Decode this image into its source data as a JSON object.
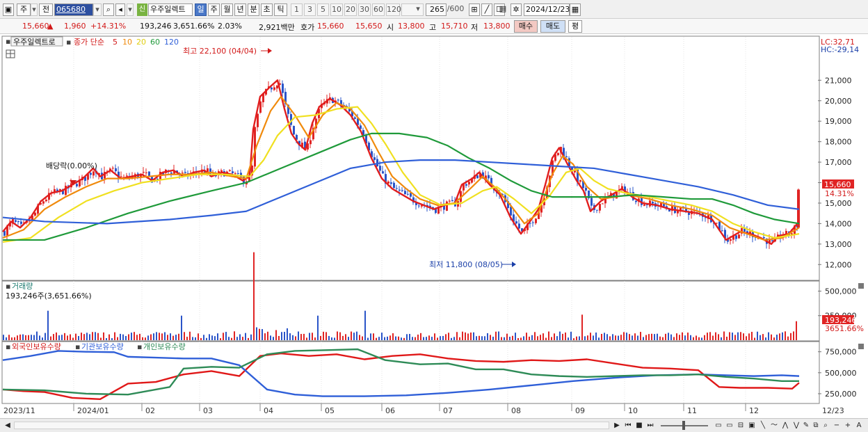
{
  "toolbar": {
    "market": "주",
    "prev": "전",
    "code": "065680",
    "name": "우주일렉트",
    "sin_badge": "신",
    "periods": [
      "일",
      "주",
      "월",
      "년",
      "분",
      "초",
      "틱"
    ],
    "ticks": [
      "1",
      "3",
      "5",
      "10",
      "20",
      "30",
      "60",
      "120"
    ],
    "count": "265",
    "count_total": "/600",
    "date": "2024/12/23"
  },
  "quote": {
    "price": "15,660",
    "change": "1,960",
    "change_pct": "+14.31%",
    "volume": "193,246",
    "volume_ratio": "3,651.66%",
    "turnover_pct": "2.03%",
    "amount": "2,921백만",
    "hoga_label": "호가",
    "ask": "15,660",
    "bid": "15,650",
    "open_label": "시",
    "open": "13,800",
    "high_label": "고",
    "high": "15,710",
    "low_label": "저",
    "low": "13,800",
    "buy": "매수",
    "sell": "매도",
    "eval": "평"
  },
  "price_panel": {
    "name": "우주일렉트로",
    "ma_title": "종가 단순",
    "ma_periods": [
      {
        "label": "5",
        "color": "#e11d1d"
      },
      {
        "label": "10",
        "color": "#f08a0c"
      },
      {
        "label": "20",
        "color": "#f0e020"
      },
      {
        "label": "60",
        "color": "#1f9a3a"
      },
      {
        "label": "120",
        "color": "#2f5fd8"
      }
    ],
    "lc": "LC:32,71",
    "hc": "HC:-29,14",
    "y_ticks": [
      "21,000",
      "20,000",
      "19,000",
      "18,000",
      "17,000",
      "16,000",
      "15,000",
      "14,000",
      "13,000",
      "12,000"
    ],
    "last_price_tag": "15,660",
    "last_pct_tag": "14.31%",
    "high_note": "최고 22,100 (04/04)",
    "low_note": "최저 11,800 (08/05)",
    "dividend_note": "배당락(0.00%)"
  },
  "volume_panel": {
    "title": "거래량",
    "value": "193,246주(3,651.66%)",
    "y_ticks": [
      "500,000",
      "250,000"
    ],
    "last_tag": "193,246",
    "pct_tag": "3651.66%"
  },
  "holdings_panel": {
    "series": [
      {
        "label": "외국인보유수량",
        "color": "#e01818"
      },
      {
        "label": "기관보유수량",
        "color": "#2f5fd8"
      },
      {
        "label": "개인보유수량",
        "color": "#2e8b57"
      }
    ],
    "y_ticks": [
      "750,000",
      "500,000",
      "250,000"
    ]
  },
  "x_axis": {
    "labels": [
      "2023/11",
      "2024/01",
      "02",
      "03",
      "04",
      "05",
      "06",
      "07",
      "08",
      "09",
      "10",
      "11",
      "12",
      "12/23"
    ]
  },
  "chart_data": {
    "type": "line",
    "title": "",
    "price_ylim": [
      11500,
      22200
    ],
    "volume_ylim": [
      0,
      560000
    ],
    "holdings_ylim": [
      150000,
      830000
    ],
    "ma": {
      "ma5": [
        [
          0,
          13600
        ],
        [
          12,
          14100
        ],
        [
          25,
          13800
        ],
        [
          40,
          14300
        ],
        [
          55,
          15100
        ],
        [
          70,
          15500
        ],
        [
          85,
          15600
        ],
        [
          100,
          15900
        ],
        [
          115,
          16200
        ],
        [
          130,
          16700
        ],
        [
          140,
          16300
        ],
        [
          155,
          16600
        ],
        [
          170,
          16200
        ],
        [
          185,
          16300
        ],
        [
          200,
          16400
        ],
        [
          215,
          16100
        ],
        [
          230,
          16500
        ],
        [
          245,
          16600
        ],
        [
          260,
          16300
        ],
        [
          275,
          16500
        ],
        [
          290,
          16600
        ],
        [
          300,
          16300
        ],
        [
          315,
          16500
        ],
        [
          330,
          16400
        ],
        [
          345,
          16100
        ],
        [
          355,
          16300
        ],
        [
          360,
          18600
        ],
        [
          370,
          20200
        ],
        [
          385,
          20700
        ],
        [
          395,
          21000
        ],
        [
          405,
          19600
        ],
        [
          415,
          18400
        ],
        [
          425,
          17900
        ],
        [
          435,
          17600
        ],
        [
          445,
          18900
        ],
        [
          455,
          19700
        ],
        [
          470,
          20100
        ],
        [
          485,
          19800
        ],
        [
          500,
          19300
        ],
        [
          515,
          18500
        ],
        [
          530,
          17200
        ],
        [
          545,
          16200
        ],
        [
          560,
          15700
        ],
        [
          575,
          15400
        ],
        [
          590,
          15100
        ],
        [
          605,
          14900
        ],
        [
          620,
          14700
        ],
        [
          635,
          14900
        ],
        [
          650,
          15000
        ],
        [
          660,
          15900
        ],
        [
          675,
          16200
        ],
        [
          685,
          16500
        ],
        [
          700,
          15900
        ],
        [
          715,
          15400
        ],
        [
          730,
          14300
        ],
        [
          745,
          13500
        ],
        [
          760,
          14200
        ],
        [
          770,
          14700
        ],
        [
          780,
          15900
        ],
        [
          790,
          17200
        ],
        [
          800,
          17700
        ],
        [
          812,
          16900
        ],
        [
          825,
          16100
        ],
        [
          835,
          15600
        ],
        [
          845,
          14600
        ],
        [
          860,
          15100
        ],
        [
          875,
          15400
        ],
        [
          890,
          15700
        ],
        [
          905,
          15300
        ],
        [
          920,
          15000
        ],
        [
          940,
          14900
        ],
        [
          960,
          14700
        ],
        [
          980,
          14600
        ],
        [
          1000,
          14500
        ],
        [
          1020,
          14200
        ],
        [
          1040,
          13200
        ],
        [
          1060,
          13600
        ],
        [
          1075,
          13500
        ],
        [
          1090,
          13300
        ],
        [
          1105,
          13000
        ],
        [
          1115,
          13400
        ],
        [
          1130,
          13500
        ],
        [
          1145,
          14100
        ]
      ],
      "ma10": [
        [
          0,
          13300
        ],
        [
          30,
          13700
        ],
        [
          60,
          14700
        ],
        [
          90,
          15300
        ],
        [
          120,
          15800
        ],
        [
          150,
          16200
        ],
        [
          180,
          16200
        ],
        [
          210,
          16300
        ],
        [
          240,
          16400
        ],
        [
          270,
          16400
        ],
        [
          300,
          16500
        ],
        [
          330,
          16300
        ],
        [
          350,
          16200
        ],
        [
          365,
          17800
        ],
        [
          385,
          19500
        ],
        [
          400,
          20200
        ],
        [
          420,
          19300
        ],
        [
          440,
          18200
        ],
        [
          460,
          19300
        ],
        [
          480,
          19900
        ],
        [
          500,
          19600
        ],
        [
          520,
          18800
        ],
        [
          540,
          17500
        ],
        [
          560,
          16300
        ],
        [
          580,
          15700
        ],
        [
          600,
          15200
        ],
        [
          625,
          14900
        ],
        [
          650,
          15000
        ],
        [
          675,
          15800
        ],
        [
          690,
          16300
        ],
        [
          710,
          15700
        ],
        [
          730,
          14900
        ],
        [
          750,
          14000
        ],
        [
          770,
          14500
        ],
        [
          790,
          16400
        ],
        [
          805,
          17300
        ],
        [
          820,
          16900
        ],
        [
          840,
          15800
        ],
        [
          860,
          15200
        ],
        [
          880,
          15300
        ],
        [
          900,
          15400
        ],
        [
          930,
          15200
        ],
        [
          960,
          14900
        ],
        [
          990,
          14700
        ],
        [
          1020,
          14400
        ],
        [
          1045,
          13800
        ],
        [
          1070,
          13500
        ],
        [
          1095,
          13200
        ],
        [
          1120,
          13300
        ],
        [
          1145,
          13800
        ]
      ],
      "ma20": [
        [
          0,
          13100
        ],
        [
          40,
          13300
        ],
        [
          80,
          14300
        ],
        [
          120,
          15100
        ],
        [
          160,
          15600
        ],
        [
          200,
          16000
        ],
        [
          240,
          16200
        ],
        [
          280,
          16400
        ],
        [
          320,
          16400
        ],
        [
          355,
          16300
        ],
        [
          375,
          17100
        ],
        [
          395,
          18300
        ],
        [
          420,
          19200
        ],
        [
          450,
          19300
        ],
        [
          480,
          19600
        ],
        [
          510,
          19700
        ],
        [
          530,
          18900
        ],
        [
          550,
          17900
        ],
        [
          575,
          16500
        ],
        [
          600,
          15400
        ],
        [
          630,
          14900
        ],
        [
          660,
          15000
        ],
        [
          690,
          15600
        ],
        [
          710,
          15800
        ],
        [
          735,
          15200
        ],
        [
          760,
          14500
        ],
        [
          785,
          15300
        ],
        [
          810,
          16500
        ],
        [
          830,
          16700
        ],
        [
          850,
          16100
        ],
        [
          870,
          15700
        ],
        [
          895,
          15500
        ],
        [
          930,
          15300
        ],
        [
          960,
          15100
        ],
        [
          990,
          14900
        ],
        [
          1020,
          14600
        ],
        [
          1050,
          14000
        ],
        [
          1080,
          13600
        ],
        [
          1110,
          13300
        ],
        [
          1145,
          13500
        ]
      ],
      "ma60": [
        [
          0,
          13200
        ],
        [
          60,
          13200
        ],
        [
          120,
          13800
        ],
        [
          180,
          14500
        ],
        [
          240,
          15100
        ],
        [
          300,
          15600
        ],
        [
          350,
          16000
        ],
        [
          400,
          16700
        ],
        [
          450,
          17400
        ],
        [
          500,
          18100
        ],
        [
          530,
          18400
        ],
        [
          570,
          18400
        ],
        [
          610,
          18200
        ],
        [
          640,
          17800
        ],
        [
          670,
          17200
        ],
        [
          700,
          16700
        ],
        [
          730,
          16100
        ],
        [
          760,
          15600
        ],
        [
          790,
          15300
        ],
        [
          830,
          15300
        ],
        [
          870,
          15300
        ],
        [
          910,
          15400
        ],
        [
          950,
          15300
        ],
        [
          990,
          15200
        ],
        [
          1020,
          15200
        ],
        [
          1050,
          14900
        ],
        [
          1080,
          14500
        ],
        [
          1110,
          14200
        ],
        [
          1145,
          14000
        ]
      ],
      "ma120": [
        [
          0,
          14300
        ],
        [
          60,
          14100
        ],
        [
          150,
          14000
        ],
        [
          240,
          14200
        ],
        [
          300,
          14400
        ],
        [
          350,
          14600
        ],
        [
          400,
          15300
        ],
        [
          450,
          16000
        ],
        [
          500,
          16700
        ],
        [
          550,
          17000
        ],
        [
          600,
          17100
        ],
        [
          650,
          17100
        ],
        [
          700,
          17000
        ],
        [
          750,
          16900
        ],
        [
          800,
          16800
        ],
        [
          850,
          16700
        ],
        [
          900,
          16400
        ],
        [
          950,
          16100
        ],
        [
          1000,
          15800
        ],
        [
          1050,
          15400
        ],
        [
          1100,
          14900
        ],
        [
          1145,
          14700
        ]
      ]
    },
    "holdings": {
      "foreign": [
        [
          0,
          300000
        ],
        [
          30,
          280000
        ],
        [
          60,
          270000
        ],
        [
          100,
          200000
        ],
        [
          140,
          185000
        ],
        [
          180,
          370000
        ],
        [
          220,
          390000
        ],
        [
          260,
          480000
        ],
        [
          300,
          520000
        ],
        [
          340,
          460000
        ],
        [
          370,
          700000
        ],
        [
          400,
          730000
        ],
        [
          440,
          700000
        ],
        [
          480,
          720000
        ],
        [
          520,
          660000
        ],
        [
          560,
          700000
        ],
        [
          600,
          720000
        ],
        [
          640,
          670000
        ],
        [
          680,
          640000
        ],
        [
          720,
          630000
        ],
        [
          760,
          650000
        ],
        [
          800,
          640000
        ],
        [
          840,
          660000
        ],
        [
          880,
          610000
        ],
        [
          920,
          560000
        ],
        [
          960,
          550000
        ],
        [
          1000,
          530000
        ],
        [
          1030,
          330000
        ],
        [
          1060,
          320000
        ],
        [
          1100,
          320000
        ],
        [
          1135,
          310000
        ],
        [
          1145,
          380000
        ]
      ],
      "institution": [
        [
          0,
          650000
        ],
        [
          40,
          700000
        ],
        [
          80,
          760000
        ],
        [
          120,
          750000
        ],
        [
          160,
          745000
        ],
        [
          180,
          690000
        ],
        [
          220,
          680000
        ],
        [
          260,
          670000
        ],
        [
          300,
          670000
        ],
        [
          340,
          590000
        ],
        [
          380,
          300000
        ],
        [
          420,
          240000
        ],
        [
          460,
          220000
        ],
        [
          520,
          220000
        ],
        [
          580,
          230000
        ],
        [
          640,
          260000
        ],
        [
          700,
          300000
        ],
        [
          760,
          350000
        ],
        [
          820,
          400000
        ],
        [
          880,
          440000
        ],
        [
          940,
          470000
        ],
        [
          1000,
          480000
        ],
        [
          1040,
          470000
        ],
        [
          1080,
          460000
        ],
        [
          1120,
          470000
        ],
        [
          1145,
          460000
        ]
      ],
      "individual": [
        [
          0,
          300000
        ],
        [
          60,
          290000
        ],
        [
          120,
          250000
        ],
        [
          180,
          240000
        ],
        [
          240,
          330000
        ],
        [
          260,
          550000
        ],
        [
          300,
          570000
        ],
        [
          340,
          560000
        ],
        [
          380,
          720000
        ],
        [
          420,
          760000
        ],
        [
          470,
          770000
        ],
        [
          510,
          780000
        ],
        [
          550,
          650000
        ],
        [
          600,
          600000
        ],
        [
          640,
          610000
        ],
        [
          680,
          540000
        ],
        [
          720,
          540000
        ],
        [
          760,
          480000
        ],
        [
          800,
          460000
        ],
        [
          840,
          450000
        ],
        [
          880,
          460000
        ],
        [
          920,
          470000
        ],
        [
          960,
          470000
        ],
        [
          1000,
          480000
        ],
        [
          1040,
          450000
        ],
        [
          1080,
          430000
        ],
        [
          1120,
          400000
        ],
        [
          1145,
          400000
        ]
      ]
    }
  }
}
